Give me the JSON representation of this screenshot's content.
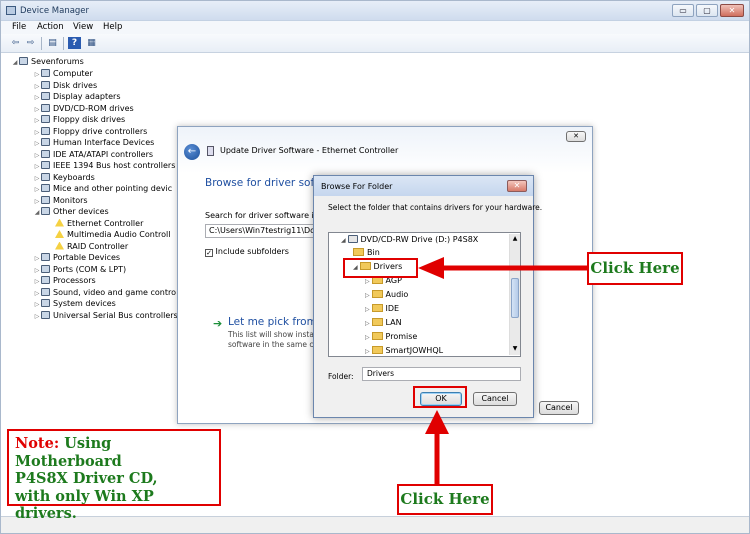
{
  "window": {
    "title": "Device Manager",
    "controls": {
      "minimize": "▭",
      "maximize": "▢",
      "close": "✕"
    }
  },
  "menu": [
    "File",
    "Action",
    "View",
    "Help"
  ],
  "tree": {
    "root": "Sevenforums",
    "items": [
      "Computer",
      "Disk drives",
      "Display adapters",
      "DVD/CD-ROM drives",
      "Floppy disk drives",
      "Floppy drive controllers",
      "Human Interface Devices",
      "IDE ATA/ATAPI controllers",
      "IEEE 1394 Bus host controllers",
      "Keyboards",
      "Mice and other pointing devic",
      "Monitors",
      "Other devices"
    ],
    "other_children": [
      "Ethernet Controller",
      "Multimedia Audio Controll",
      "RAID Controller"
    ],
    "items_after": [
      "Portable Devices",
      "Ports (COM & LPT)",
      "Processors",
      "Sound, video and game contro",
      "System devices",
      "Universal Serial Bus controllers"
    ]
  },
  "update_dialog": {
    "title": "Update Driver Software - Ethernet Controller",
    "heading": "Browse for driver softw",
    "search_label": "Search for driver software in th",
    "path_value": "C:\\Users\\Win7testrig11\\Docu",
    "include_subfolders": "Include subfolders",
    "pick_title": "Let me pick from a",
    "pick_desc1": "This list will show installe",
    "pick_desc2": "software in the same cat",
    "cancel": "Cancel",
    "close": "✕"
  },
  "browse_dialog": {
    "title": "Browse For Folder",
    "instruction": "Select the folder that contains drivers for your hardware.",
    "drive": "DVD/CD-RW Drive (D:) P4S8X",
    "folders": [
      "Bin",
      "Drivers",
      "AGP",
      "Audio",
      "IDE",
      "LAN",
      "Promise",
      "SmartJOWHQL"
    ],
    "folder_label": "Folder:",
    "folder_value": "Drivers",
    "ok": "OK",
    "cancel": "Cancel",
    "close": "✕"
  },
  "annotations": {
    "note_prefix": "Note:",
    "note_line1": " Using Motherboard",
    "note_line2": "P4S8X Driver CD,",
    "note_line3": "with only Win XP drivers.",
    "click_right": "Click Here",
    "click_bottom": "Click Here"
  },
  "colors": {
    "annotation_red": "#e00000",
    "annotation_green": "#1d7a1d",
    "link_blue": "#1f4fa1"
  }
}
